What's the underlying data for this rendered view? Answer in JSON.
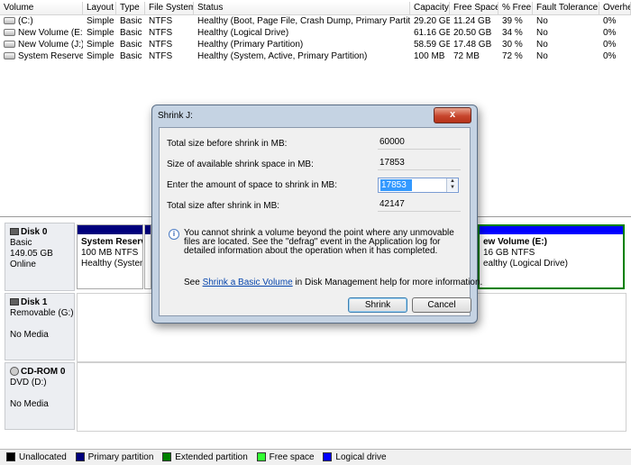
{
  "columns": [
    "Volume",
    "Layout",
    "Type",
    "File System",
    "Status",
    "Capacity",
    "Free Space",
    "% Free",
    "Fault Tolerance",
    "Overhe"
  ],
  "volumes": [
    {
      "volume": "(C:)",
      "layout": "Simple",
      "type": "Basic",
      "fs": "NTFS",
      "status": "Healthy (Boot, Page File, Crash Dump, Primary Partition)",
      "capacity": "29.20 GB",
      "free": "11.24 GB",
      "pct": "39 %",
      "fault": "No",
      "overhead": "0%"
    },
    {
      "volume": "New Volume (E:)",
      "layout": "Simple",
      "type": "Basic",
      "fs": "NTFS",
      "status": "Healthy (Logical Drive)",
      "capacity": "61.16 GB",
      "free": "20.50 GB",
      "pct": "34 %",
      "fault": "No",
      "overhead": "0%"
    },
    {
      "volume": "New Volume (J:)",
      "layout": "Simple",
      "type": "Basic",
      "fs": "NTFS",
      "status": "Healthy (Primary Partition)",
      "capacity": "58.59 GB",
      "free": "17.48 GB",
      "pct": "30 %",
      "fault": "No",
      "overhead": "0%"
    },
    {
      "volume": "System Reserved",
      "layout": "Simple",
      "type": "Basic",
      "fs": "NTFS",
      "status": "Healthy (System, Active, Primary Partition)",
      "capacity": "100 MB",
      "free": "72 MB",
      "pct": "72 %",
      "fault": "No",
      "overhead": "0%"
    }
  ],
  "disks": {
    "disk0": {
      "name": "Disk 0",
      "type": "Basic",
      "size": "149.05 GB",
      "state": "Online"
    },
    "disk1": {
      "name": "Disk 1",
      "type": "Removable (G:)",
      "state": "No Media"
    },
    "cdrom0": {
      "name": "CD-ROM 0",
      "type": "DVD (D:)",
      "state": "No Media"
    }
  },
  "partitions": {
    "system_reserved": {
      "name": "System Reserv",
      "size": "100 MB NTFS",
      "status": "Healthy (Systen"
    },
    "new_volume_e": {
      "name": "ew Volume  (E:)",
      "size": "16 GB NTFS",
      "status": "ealthy (Logical Drive)"
    }
  },
  "legend": [
    {
      "label": "Unallocated",
      "color": "#000000"
    },
    {
      "label": "Primary partition",
      "color": "#00007c"
    },
    {
      "label": "Extended partition",
      "color": "#008000"
    },
    {
      "label": "Free space",
      "color": "#33ff33"
    },
    {
      "label": "Logical drive",
      "color": "#0000ff"
    }
  ],
  "dialog": {
    "title": "Shrink J:",
    "close_label": "x",
    "total_before_label": "Total size before shrink in MB:",
    "total_before_value": "60000",
    "available_label": "Size of available shrink space in MB:",
    "available_value": "17853",
    "amount_label": "Enter the amount of space to shrink in MB:",
    "amount_value": "17853",
    "total_after_label": "Total size after shrink in MB:",
    "total_after_value": "42147",
    "info_text": "You cannot shrink a volume beyond the point where any unmovable files are located. See the \"defrag\" event in the Application log for detailed information about the operation when it has completed.",
    "help_prefix": "See ",
    "help_link": "Shrink a Basic Volume",
    "help_suffix": " in Disk Management help for more information.",
    "shrink_button": "Shrink",
    "cancel_button": "Cancel"
  }
}
